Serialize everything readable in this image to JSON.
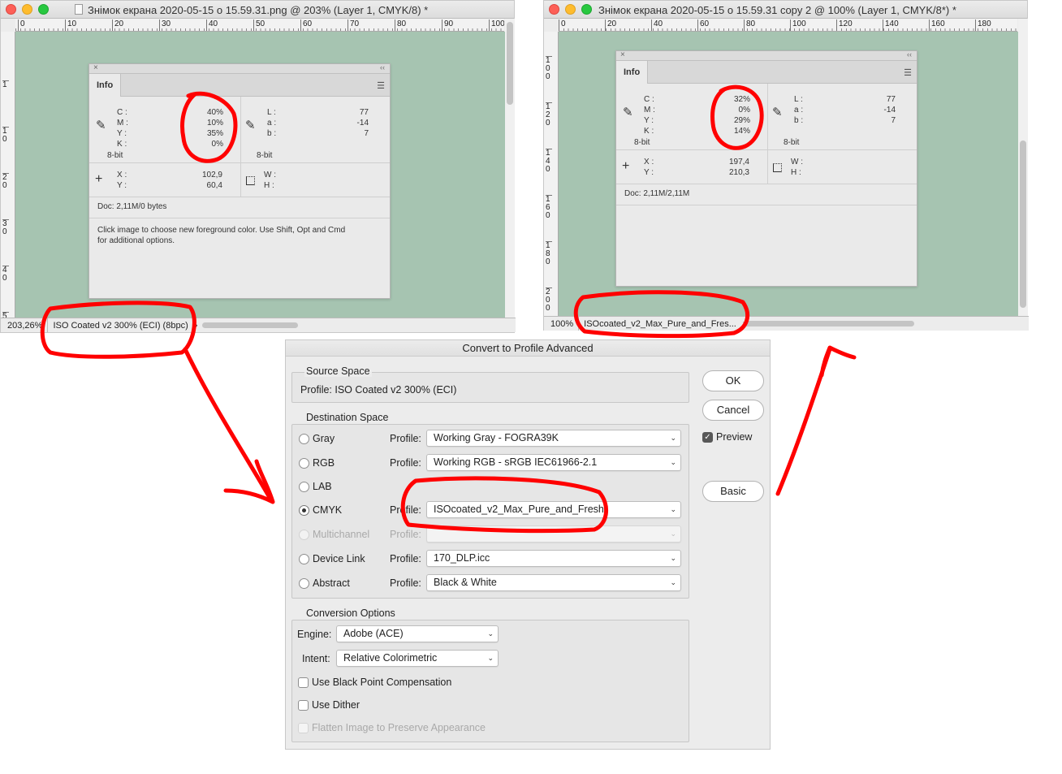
{
  "colors": {
    "annotation": "#ff0000",
    "canvas": "#a6c4b1"
  },
  "left_window": {
    "title": "Знімок екрана 2020-05-15 о 15.59.31.png @ 203% (Layer 1, CMYK/8) *",
    "ruler_h": [
      "0",
      "10",
      "20",
      "30",
      "40",
      "50",
      "60",
      "70",
      "80",
      "90",
      "100"
    ],
    "ruler_v": [
      "1",
      "1 0",
      "2 0",
      "3 0",
      "4 0",
      "5 0"
    ],
    "zoom": "203,26%",
    "profile": "ISO Coated v2 300% (ECI) (8bpc)",
    "status_arrow": "›",
    "info": {
      "tab": "Info",
      "cmyk_labels": [
        "C :",
        "M :",
        "Y :",
        "K :"
      ],
      "cmyk_values": [
        "40%",
        "10%",
        "35%",
        "0%"
      ],
      "lab_labels": [
        "L :",
        "a :",
        "b :"
      ],
      "lab_values": [
        "77",
        "-14",
        "7"
      ],
      "bits": "8-bit",
      "xy_labels": [
        "X :",
        "Y :"
      ],
      "xy_values": [
        "102,9",
        "60,4"
      ],
      "wh_labels": [
        "W :",
        "H :"
      ],
      "doc": "Doc: 2,11M/0 bytes",
      "hint_line1": "Click image to choose new foreground color.  Use Shift, Opt and Cmd",
      "hint_line2": "for additional options."
    }
  },
  "right_window": {
    "title": "Знімок екрана 2020-05-15 о 15.59.31 copy 2 @ 100% (Layer 1, CMYK/8*) *",
    "ruler_h": [
      "0",
      "20",
      "40",
      "60",
      "80",
      "100",
      "120",
      "140",
      "160",
      "180"
    ],
    "ruler_v": [
      "1 0 0",
      "1 2 0",
      "1 4 0",
      "1 6 0",
      "1 8 0",
      "2 0 0"
    ],
    "zoom": "100%",
    "profile": "ISOcoated_v2_Max_Pure_and_Fres...",
    "status_arrow": "›",
    "info": {
      "tab": "Info",
      "cmyk_labels": [
        "C :",
        "M :",
        "Y :",
        "K :"
      ],
      "cmyk_values": [
        "32%",
        "0%",
        "29%",
        "14%"
      ],
      "lab_labels": [
        "L :",
        "a :",
        "b :"
      ],
      "lab_values": [
        "77",
        "-14",
        "7"
      ],
      "bits": "8-bit",
      "xy_labels": [
        "X :",
        "Y :"
      ],
      "xy_values": [
        "197,4",
        "210,3"
      ],
      "wh_labels": [
        "W :",
        "H :"
      ],
      "doc": "Doc: 2,11M/2,11M"
    }
  },
  "dialog": {
    "title": "Convert to Profile Advanced",
    "source": {
      "group": "Source Space",
      "profile_line": "Profile:  ISO Coated v2 300% (ECI)"
    },
    "destination": {
      "group": "Destination Space",
      "profile_label": "Profile:",
      "rows": [
        {
          "label": "Gray",
          "value": "Working Gray - FOGRA39K"
        },
        {
          "label": "RGB",
          "value": "Working RGB - sRGB IEC61966-2.1"
        },
        {
          "label": "LAB",
          "value": ""
        },
        {
          "label": "CMYK",
          "value": "ISOcoated_v2_Max_Pure_and_Fresh"
        },
        {
          "label": "Multichannel",
          "value": ""
        },
        {
          "label": "Device Link",
          "value": "170_DLP.icc"
        },
        {
          "label": "Abstract",
          "value": "Black & White"
        }
      ]
    },
    "conversion": {
      "group": "Conversion Options",
      "engine_label": "Engine:",
      "engine": "Adobe (ACE)",
      "intent_label": "Intent:",
      "intent": "Relative Colorimetric",
      "bpc": "Use Black Point Compensation",
      "dither": "Use Dither",
      "flatten": "Flatten Image to Preserve Appearance"
    },
    "buttons": {
      "ok": "OK",
      "cancel": "Cancel",
      "preview": "Preview",
      "basic": "Basic"
    }
  }
}
